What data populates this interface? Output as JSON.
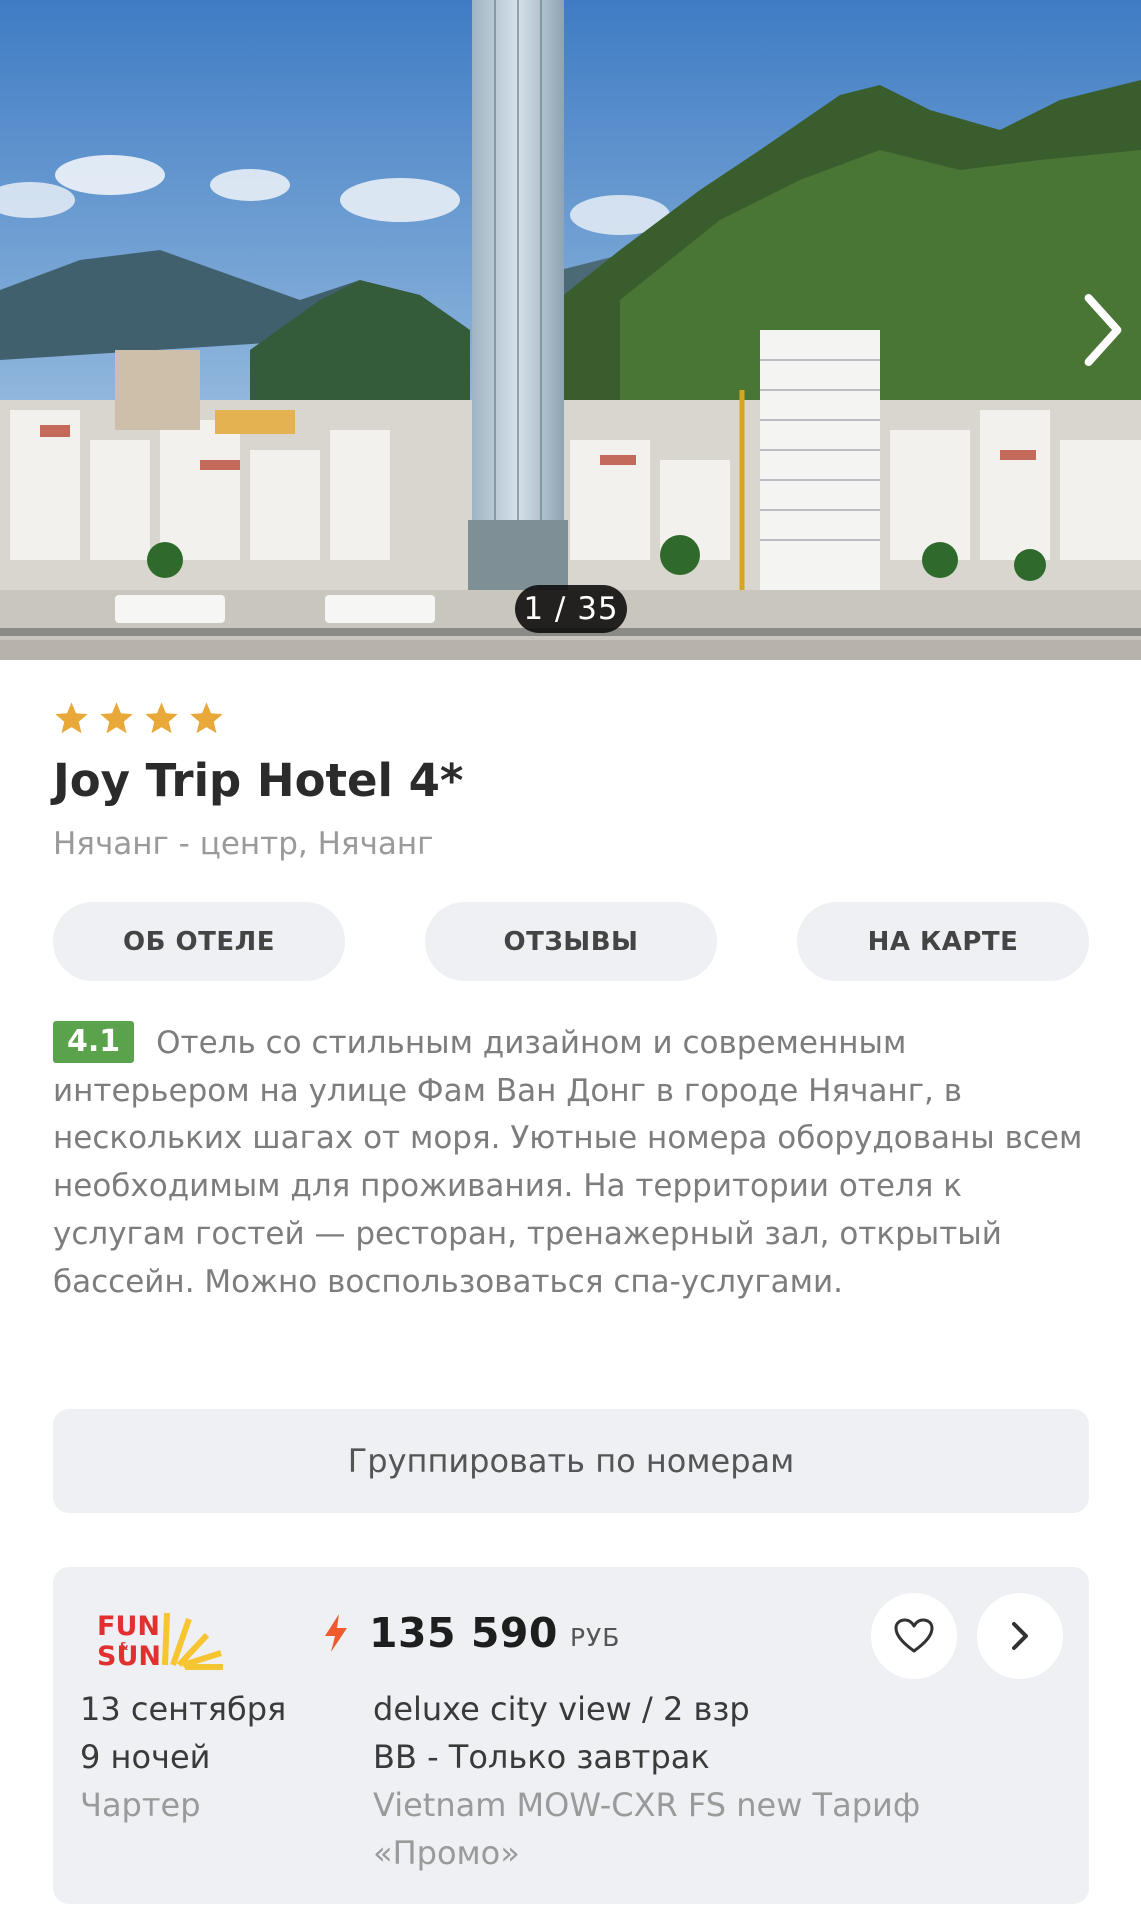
{
  "gallery": {
    "counter": "1 / 35"
  },
  "hotel": {
    "stars": 4,
    "name": "Joy Trip Hotel 4*",
    "location": "Нячанг - центр, Нячанг"
  },
  "tabs": [
    {
      "label": "ОБ ОТЕЛЕ"
    },
    {
      "label": "ОТЗЫВЫ"
    },
    {
      "label": "НА КАРТЕ"
    }
  ],
  "description": {
    "rating": "4.1",
    "text": "Отель со стильным дизайном и современным интерьером на улице Фам Ван Донг в городе Нячанг, в нескольких шагах от моря. Уютные номера оборудованы всем необходимым для проживания. На территории отеля к услугам гостей — ресторан, тренажерный зал, открытый бассейн. Можно воспользоваться спа-услугами."
  },
  "group_button": {
    "label": "Группировать по номерам"
  },
  "offer": {
    "operator_logo": "FUN&SUN",
    "price": "135 590",
    "currency": "РУБ",
    "date": "13 сентября",
    "nights": "9 ночей",
    "flight_type": "Чартер",
    "room": "deluxe city view / 2 взр",
    "meal": "BB - Только завтрак",
    "tariff": "Vietnam MOW-CXR FS new Тариф «Промо»"
  },
  "icons": {
    "gallery_next": "chevron-right-icon",
    "star": "star-icon",
    "bolt": "lightning-icon",
    "favorite": "heart-icon",
    "open": "chevron-right-icon"
  },
  "colors": {
    "star": "#e8a93a",
    "rating_badge": "#5aa34c",
    "bolt": "#ef5a2f",
    "button_bg": "#eef0f3"
  }
}
